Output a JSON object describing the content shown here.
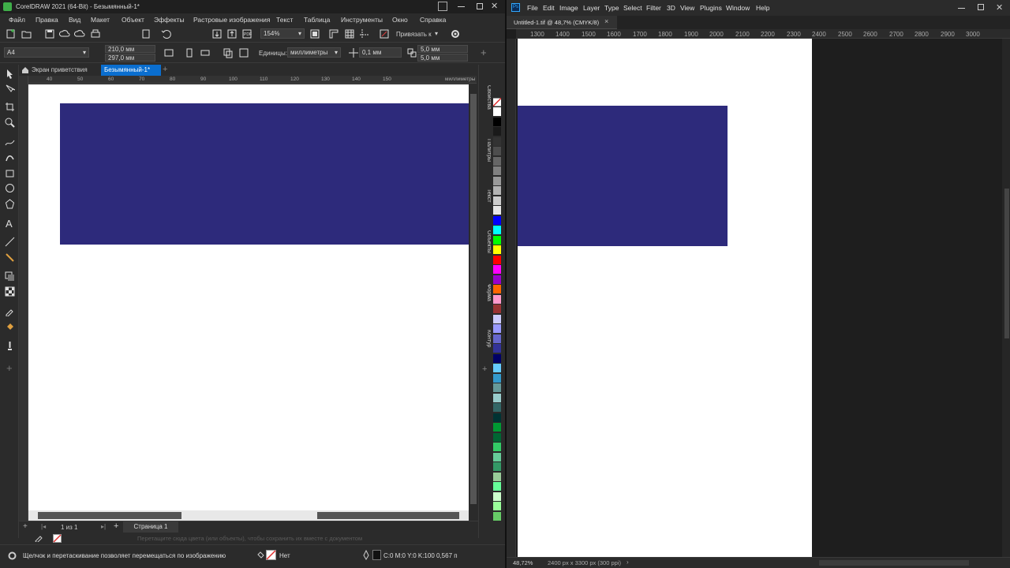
{
  "coreldraw": {
    "title": "CorelDRAW 2021 (64-Bit) - Безымянный-1*",
    "menu": [
      "Файл",
      "Правка",
      "Вид",
      "Макет",
      "Объект",
      "Эффекты",
      "Растровые изображения",
      "Текст",
      "Таблица",
      "Инструменты",
      "Окно",
      "Справка"
    ],
    "zoom": "154%",
    "snap_label": "Привязать к",
    "page_size": "A4",
    "width": "210,0 мм",
    "height": "297,0 мм",
    "units_label": "Единицы:",
    "units_value": "миллиметры",
    "nudge": "0,1 мм",
    "dup_x": "5,0 мм",
    "dup_y": "5,0 мм",
    "tabs": [
      "Экран приветствия",
      "Безымянный-1*"
    ],
    "ruler_ticks": [
      "40",
      "50",
      "60",
      "70",
      "80",
      "90",
      "100",
      "110",
      "120",
      "130",
      "140",
      "150"
    ],
    "ruler_unit": "миллиметры",
    "dock_tabs": [
      "Свойства",
      "Палитры",
      "Текст",
      "Объекты",
      "Форма",
      "Контур"
    ],
    "page_counter": "1 из 1",
    "page_tab": "Страница 1",
    "color_hint": "Перетащите сюда цвета (или объекты), чтобы сохранить их вместе с документом",
    "status_hint": "Щелчок и перетаскивание позволяет перемещаться по изображению",
    "fill_status": "Нет",
    "outline_status": "C:0 M:0 Y:0 K:100  0,567 п",
    "rect_color": "#2d2a7b",
    "palette": [
      "#ffffff",
      "#000000",
      "#1a1a1a",
      "#333333",
      "#4d4d4d",
      "#666666",
      "#808080",
      "#999999",
      "#b3b3b3",
      "#cccccc",
      "#e6e6e6",
      "#0000ff",
      "#00ffff",
      "#00ff00",
      "#ffff00",
      "#ff0000",
      "#ff00ff",
      "#9900cc",
      "#ff6600",
      "#ff99cc",
      "#993333",
      "#ccccff",
      "#9999ff",
      "#6666cc",
      "#333399",
      "#000066",
      "#66ccff",
      "#3399cc",
      "#669999",
      "#99cccc",
      "#336666",
      "#003333",
      "#009933",
      "#006633",
      "#33cc66",
      "#66cc99",
      "#339966",
      "#99cc99",
      "#66ff99",
      "#ccffcc",
      "#99ff99",
      "#66cc66"
    ]
  },
  "photoshop": {
    "menu": [
      "File",
      "Edit",
      "Image",
      "Layer",
      "Type",
      "Select",
      "Filter",
      "3D",
      "View",
      "Plugins",
      "Window",
      "Help"
    ],
    "doc_tab": "Untitled-1.tif @ 48,7% (CMYK/8)",
    "ruler_ticks": [
      "1300",
      "1400",
      "1500",
      "1600",
      "1700",
      "1800",
      "1900",
      "2000",
      "2100",
      "2200",
      "2300",
      "2400",
      "2500",
      "2600",
      "2700",
      "2800",
      "2900",
      "3000"
    ],
    "zoom": "48,72%",
    "doc_info": "2400 px x 3300 px (300 ppi)",
    "rect_color": "#2d2a7b"
  }
}
